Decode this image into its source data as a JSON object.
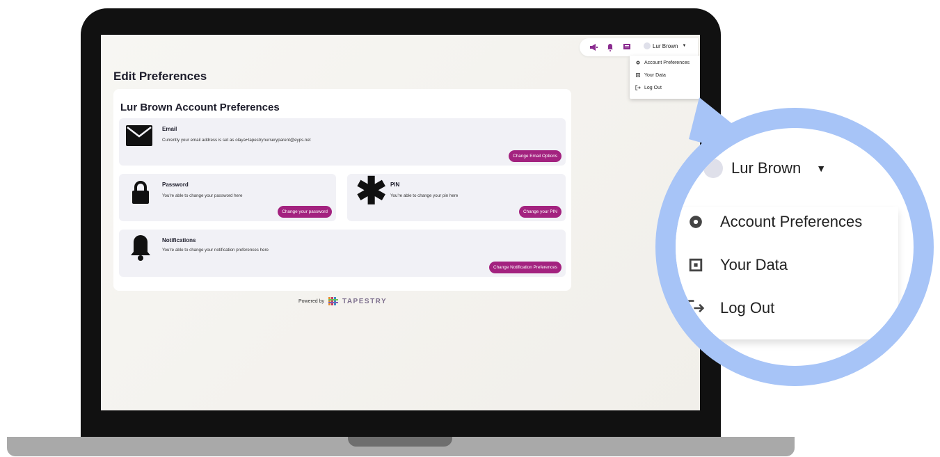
{
  "header": {
    "user_name": "Lur Brown",
    "menu": [
      {
        "label": "Account Preferences",
        "icon": "gear-icon"
      },
      {
        "label": "Your Data",
        "icon": "chip-icon"
      },
      {
        "label": "Log Out",
        "icon": "logout-icon"
      }
    ]
  },
  "page": {
    "title": "Edit Preferences",
    "card_title": "Lur Brown Account Preferences"
  },
  "email": {
    "title": "Email",
    "desc": "Currently your email address is set as olaya+tapestrynurseryparent@eyps.net",
    "button": "Change Email Options"
  },
  "password": {
    "title": "Password",
    "desc": "You're able to change your password here",
    "button": "Change your password"
  },
  "pin": {
    "title": "PIN",
    "desc": "You're able to change your pin here",
    "button": "Change your PIN"
  },
  "notifications": {
    "title": "Notifications",
    "desc": "You're able to change your notification preferences here",
    "button": "Change Notification Preferences"
  },
  "footer": {
    "powered_by": "Powered by",
    "brand": "TAPESTRY"
  },
  "colors": {
    "accent": "#a3227f",
    "magnifier_ring": "#a7c4f7",
    "topbar_icon": "#8a2b8f"
  }
}
